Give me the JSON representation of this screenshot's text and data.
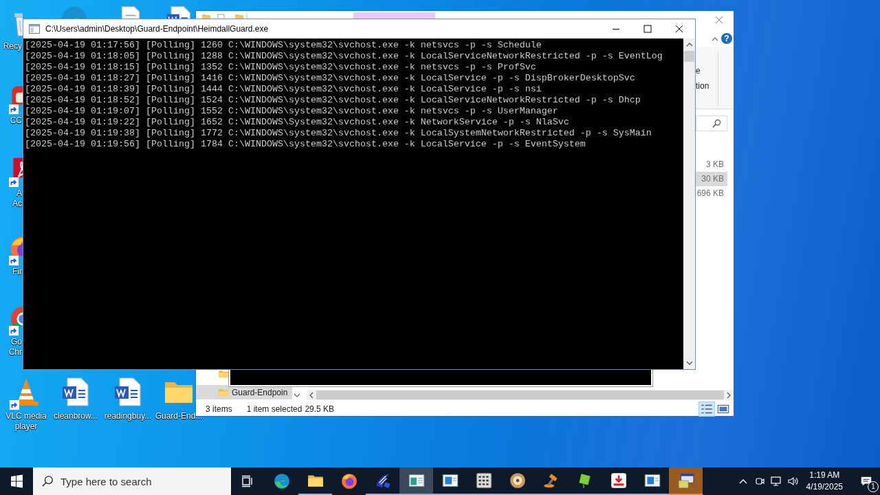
{
  "desktop": {
    "top_icons": [
      {
        "kind": "edge"
      },
      {
        "kind": "text-doc"
      },
      {
        "kind": "word"
      }
    ],
    "side_icons": [
      {
        "kind": "recycle",
        "shortcut": false,
        "lines": [
          "Recy"
        ]
      },
      {
        "kind": "cc",
        "shortcut": true,
        "lines": [
          "CC"
        ]
      },
      {
        "kind": "pdf",
        "shortcut": true,
        "lines": [
          "A",
          "Ac"
        ]
      },
      {
        "kind": "firefox",
        "shortcut": true,
        "lines": [
          "Fir"
        ]
      },
      {
        "kind": "chrome",
        "shortcut": true,
        "lines": [
          "Go",
          "Chr"
        ]
      }
    ],
    "bottom_icons": [
      {
        "kind": "vlc",
        "shortcut": true,
        "label": "VLC media player"
      },
      {
        "kind": "word",
        "shortcut": false,
        "label": "cleanbrow..."
      },
      {
        "kind": "word",
        "shortcut": false,
        "label": "readingbuy..."
      },
      {
        "kind": "folder",
        "shortcut": false,
        "label": "Guard-End..."
      }
    ]
  },
  "explorer": {
    "help": "?",
    "ribbon_texts": [
      "e",
      "tion"
    ],
    "sizes": [
      {
        "text": "3 KB",
        "selected": false
      },
      {
        "text": "30 KB",
        "selected": true
      },
      {
        "text": "696 KB",
        "selected": false
      }
    ],
    "nav_item": {
      "label": "Guard-Endpoin",
      "selected": true
    },
    "status": [
      "3 items",
      "1 item selected",
      "29.5 KB"
    ],
    "views": [
      {
        "kind": "details",
        "selected": true
      },
      {
        "kind": "preview",
        "selected": false
      }
    ]
  },
  "console": {
    "title": "C:\\Users\\admin\\Desktop\\Guard-Endpoint\\HeimdallGuard.exe",
    "lines": [
      "[2025-04-19 01:17:56] [Polling] 1260 C:\\WINDOWS\\system32\\svchost.exe -k netsvcs -p -s Schedule",
      "[2025-04-19 01:18:05] [Polling] 1288 C:\\WINDOWS\\system32\\svchost.exe -k LocalServiceNetworkRestricted -p -s EventLog",
      "[2025-04-19 01:18:15] [Polling] 1352 C:\\WINDOWS\\system32\\svchost.exe -k netsvcs -p -s ProfSvc",
      "[2025-04-19 01:18:27] [Polling] 1416 C:\\WINDOWS\\system32\\svchost.exe -k LocalService -p -s DispBrokerDesktopSvc",
      "[2025-04-19 01:18:39] [Polling] 1444 C:\\WINDOWS\\system32\\svchost.exe -k LocalService -p -s nsi",
      "[2025-04-19 01:18:52] [Polling] 1524 C:\\WINDOWS\\system32\\svchost.exe -k LocalServiceNetworkRestricted -p -s Dhcp",
      "[2025-04-19 01:19:07] [Polling] 1552 C:\\WINDOWS\\system32\\svchost.exe -k netsvcs -p -s UserManager",
      "[2025-04-19 01:19:22] [Polling] 1652 C:\\WINDOWS\\System32\\svchost.exe -k NetworkService -p -s NlaSvc",
      "[2025-04-19 01:19:38] [Polling] 1772 C:\\WINDOWS\\system32\\svchost.exe -k LocalSystemNetworkRestricted -p -s SysMain",
      "[2025-04-19 01:19:56] [Polling] 1784 C:\\WINDOWS\\system32\\svchost.exe -k LocalService -p -s EventSystem"
    ]
  },
  "taskbar": {
    "search_placeholder": "Type here to search",
    "apps": [
      {
        "kind": "edge",
        "running": false,
        "selected": false,
        "flashing": false
      },
      {
        "kind": "folder",
        "running": true,
        "selected": false,
        "flashing": false
      },
      {
        "kind": "firefox",
        "running": false,
        "selected": false,
        "flashing": false
      },
      {
        "kind": "swoosh",
        "running": true,
        "selected": false,
        "flashing": false
      },
      {
        "kind": "console",
        "running": true,
        "selected": true,
        "flashing": false
      },
      {
        "kind": "window",
        "running": true,
        "selected": false,
        "flashing": false
      },
      {
        "kind": "ppx",
        "running": true,
        "selected": false,
        "flashing": false
      },
      {
        "kind": "disc",
        "running": true,
        "selected": false,
        "flashing": false
      },
      {
        "kind": "tool",
        "running": true,
        "selected": false,
        "flashing": false
      },
      {
        "kind": "green-box",
        "running": true,
        "selected": false,
        "flashing": false
      },
      {
        "kind": "download",
        "running": true,
        "selected": false,
        "flashing": false
      },
      {
        "kind": "window",
        "running": true,
        "selected": false,
        "flashing": false
      },
      {
        "kind": "installer",
        "running": true,
        "selected": false,
        "flashing": true
      }
    ],
    "time": "1:19 AM",
    "date": "4/19/2025",
    "notifications": "1"
  }
}
